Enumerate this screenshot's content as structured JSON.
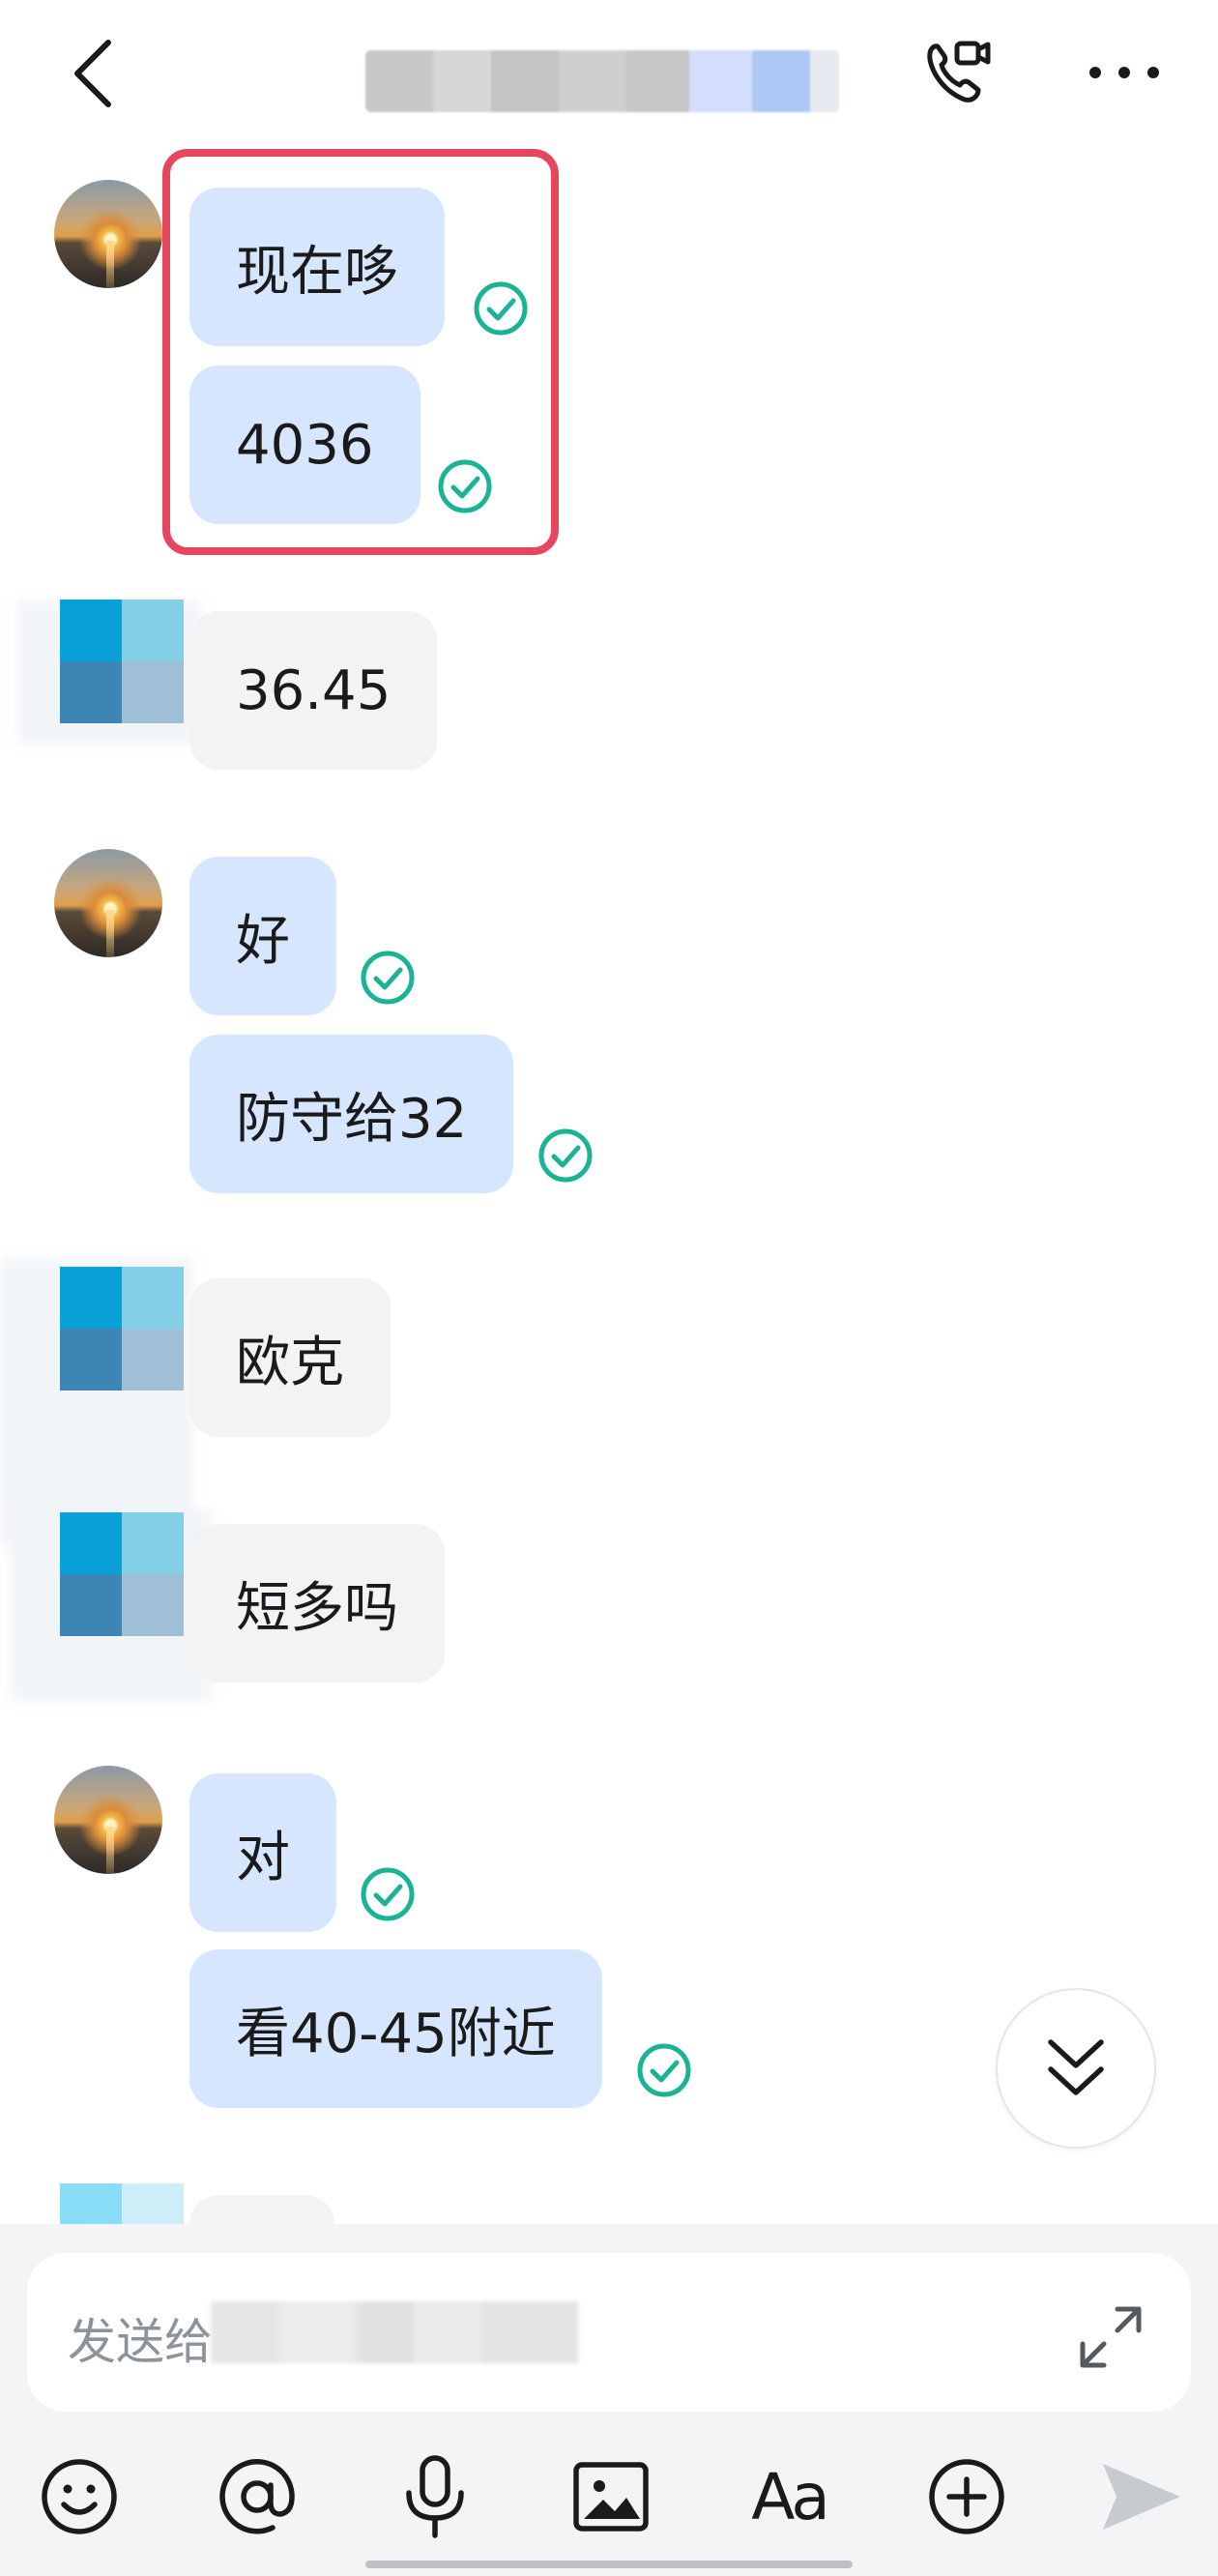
{
  "header": {
    "back_icon": "chevron-left-icon",
    "title_obscured": true,
    "call_icon": "video-call-icon",
    "more_icon": "more-horizontal-icon"
  },
  "messages": [
    {
      "sender": "me",
      "text": "现在哆",
      "status": "read"
    },
    {
      "sender": "me",
      "text": "4036",
      "status": "read"
    },
    {
      "sender": "other",
      "text": "36.45"
    },
    {
      "sender": "me",
      "text": "好",
      "status": "read"
    },
    {
      "sender": "me",
      "text": "防守给32",
      "status": "read"
    },
    {
      "sender": "other",
      "text": "欧克"
    },
    {
      "sender": "other",
      "text": "短多吗"
    },
    {
      "sender": "me",
      "text": "对",
      "status": "read"
    },
    {
      "sender": "me",
      "text": "看40-45附近",
      "status": "read"
    }
  ],
  "composer": {
    "placeholder": "发送给",
    "expand_icon": "expand-icon"
  },
  "toolbar": {
    "icons": [
      "emoji-icon",
      "mention-icon",
      "microphone-icon",
      "image-icon",
      "text-format-icon",
      "add-icon",
      "send-icon"
    ],
    "format_label": "Aa"
  },
  "colors": {
    "my_bubble": "#d6e6ff",
    "their_bubble": "#f2f3f5",
    "read_check": "#1ab394",
    "highlight_border": "#e6465e"
  }
}
